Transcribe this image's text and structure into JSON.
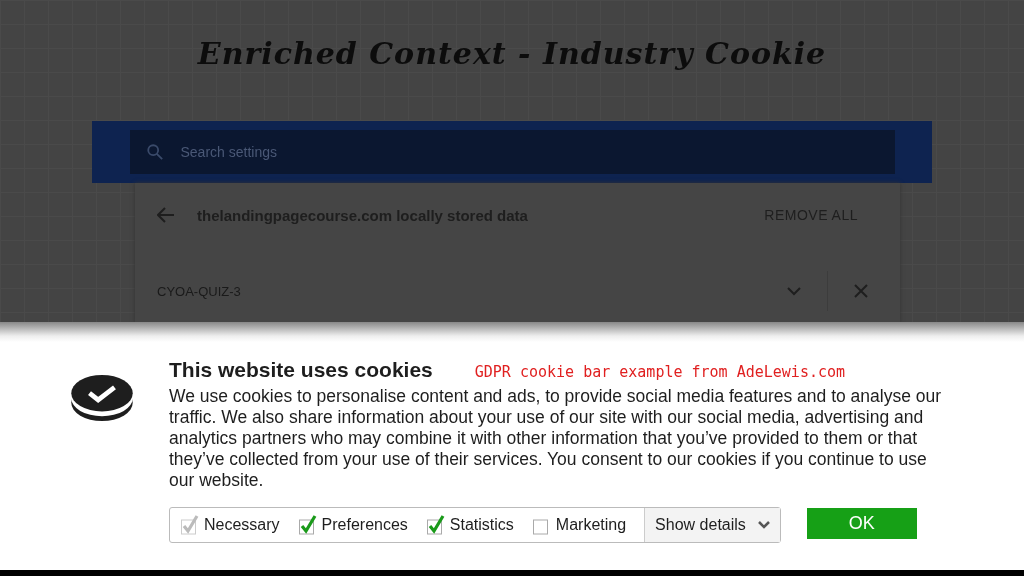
{
  "slide_title": "Enriched Context - Industry Cookie",
  "settings": {
    "search": {
      "placeholder": "Search settings"
    },
    "page_title": "thelandingpagecourse.com locally stored data",
    "remove_all": "REMOVE ALL",
    "items": [
      {
        "name": "CYOA-QUIZ-3"
      }
    ]
  },
  "cookie_bar": {
    "title": "This website uses cookies",
    "annotation": "GDPR cookie bar example from AdeLewis.com",
    "text": "We use cookies to personalise content and ads, to provide social media features and to analyse our traffic. We also share information about your use of our site with our social media, advertising and analytics partners who may combine it with other information that you’ve provided to them or that they’ve collected from your use of their services. You consent to our cookies if you continue to use our website.",
    "options": [
      {
        "label": "Necessary",
        "checked": true,
        "disabled": true
      },
      {
        "label": "Preferences",
        "checked": true,
        "disabled": false
      },
      {
        "label": "Statistics",
        "checked": true,
        "disabled": false
      },
      {
        "label": "Marketing",
        "checked": false,
        "disabled": false
      }
    ],
    "show_details": "Show details",
    "ok": "OK"
  }
}
